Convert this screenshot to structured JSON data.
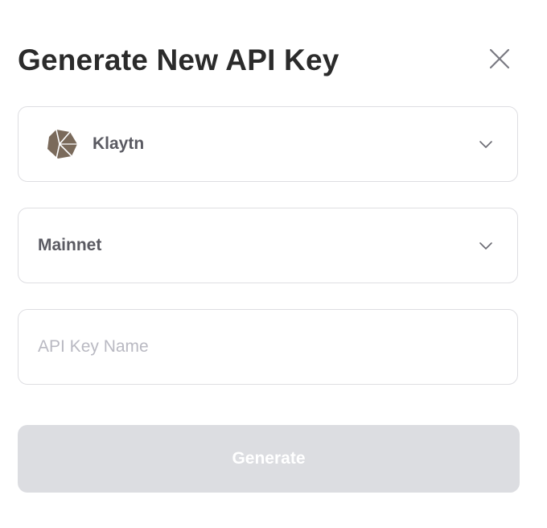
{
  "modal": {
    "title": "Generate New API Key",
    "close_icon": "close-icon"
  },
  "chain_select": {
    "selected_label": "Klaytn",
    "logo_icon": "klaytn-logo-icon",
    "logo_color": "#7a6a5b",
    "dropdown_icon": "chevron-down-icon"
  },
  "network_select": {
    "selected_label": "Mainnet",
    "dropdown_icon": "chevron-down-icon"
  },
  "api_key_name": {
    "value": "",
    "placeholder": "API Key Name"
  },
  "generate_button": {
    "label": "Generate",
    "state": "disabled",
    "background": "#dcdde1"
  }
}
